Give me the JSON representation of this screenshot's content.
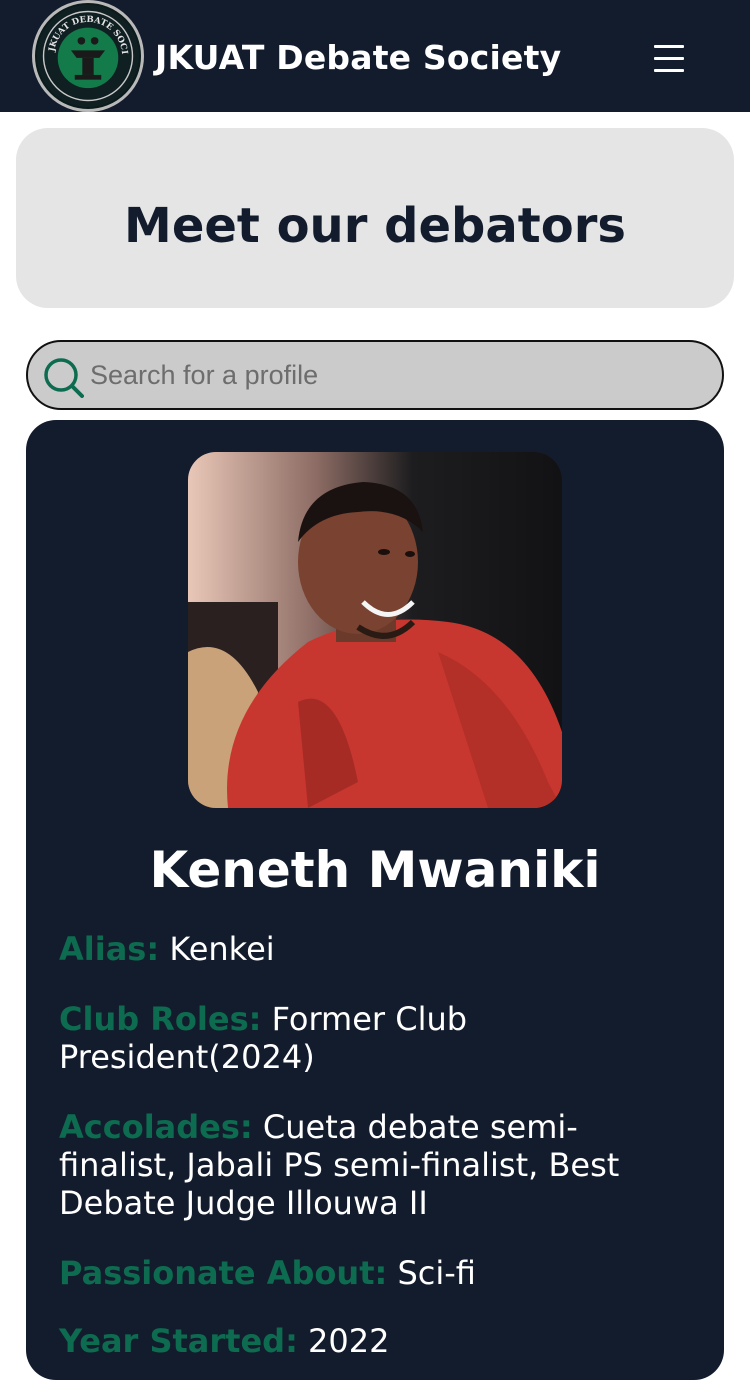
{
  "header": {
    "brand": "JKUAT Debate Society",
    "logo_text": "JKUAT DEBATE SOCIETY",
    "menu_icon": "hamburger-menu-icon"
  },
  "hero": {
    "title": "Meet our debators"
  },
  "search": {
    "placeholder": "Search for a profile",
    "value": "",
    "icon": "search-icon"
  },
  "profile": {
    "name": "Keneth Mwaniki",
    "alias_label": "Alias:",
    "alias": "Kenkei",
    "roles_label": "Club Roles:",
    "roles": "Former Club President(2024)",
    "accolades_label": "Accolades:",
    "accolades": "Cueta debate semi-finalist, Jabali PS semi-finalist, Best Debate Judge Illouwa II",
    "passion_label": "Passionate About:",
    "passion": "Sci-fi",
    "year_label": "Year Started:",
    "year": "2022"
  },
  "colors": {
    "navy": "#131c2d",
    "accent_green": "#0d6b4f",
    "hero_bg": "#e5e5e5",
    "search_bg": "#cbcbcb"
  }
}
